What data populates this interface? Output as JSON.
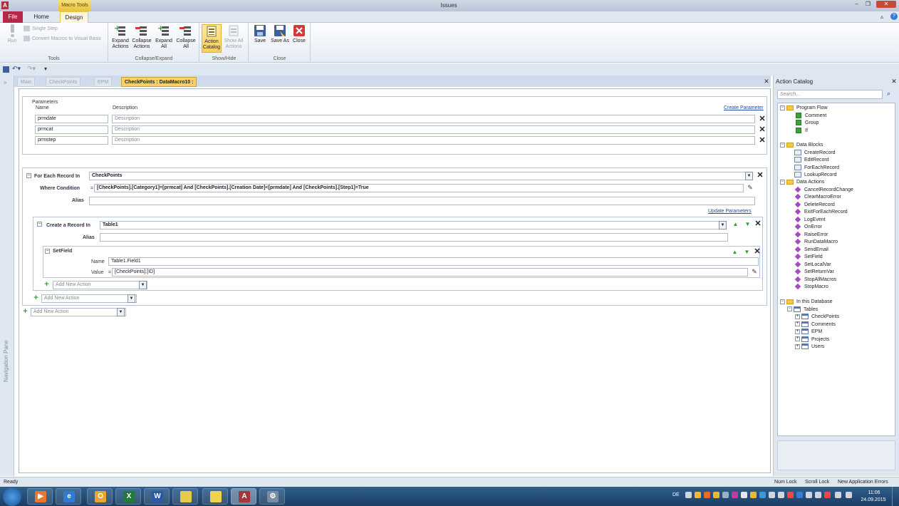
{
  "window": {
    "title": "Issues",
    "contextual_tab": "Macro Tools",
    "app_letter": "A"
  },
  "ribbon": {
    "tabs": [
      "File",
      "Home",
      "Design"
    ],
    "tools": {
      "run": "Run",
      "single_step": "Single Step",
      "convert": "Convert Macros to Visual Basic",
      "label": "Tools"
    },
    "collapse_expand": {
      "expand_actions": "Expand Actions",
      "collapse_actions": "Collapse Actions",
      "expand_all": "Expand All",
      "collapse_all": "Collapse All",
      "label": "Collapse/Expand"
    },
    "show_hide": {
      "action_catalog": "Action Catalog",
      "show_all_actions": "Show All Actions",
      "label": "Show/Hide"
    },
    "close_group": {
      "save": "Save",
      "save_as": "Save As",
      "close": "Close",
      "label": "Close"
    }
  },
  "doc_tabs": [
    "Main",
    "CheckPoints",
    "EPM",
    "CheckPoints : DataMacro10 :"
  ],
  "nav_pane": {
    "label": "Navigation Pane"
  },
  "parameters": {
    "title": "Parameters",
    "col_name": "Name",
    "col_desc": "Description",
    "create_link": "Create Parameter",
    "rows": [
      {
        "name": "prmdate",
        "desc_placeholder": "Description"
      },
      {
        "name": "prmcat",
        "desc_placeholder": "Description"
      },
      {
        "name": "prmstep",
        "desc_placeholder": "Description"
      }
    ]
  },
  "foreach": {
    "label": "For Each Record In",
    "value": "CheckPoints",
    "where_label": "Where Condition",
    "where_eq": "=",
    "where_value": "[CheckPoints].[Category1]=[prmcat] And [CheckPoints].[Creation Date]<[prmdate] And [CheckPoints].[Step1]=True",
    "alias_label": "Alias",
    "update_link": "Update Parameters"
  },
  "create_record": {
    "label": "Create a Record In",
    "value": "Table1",
    "alias_label": "Alias"
  },
  "setfield": {
    "label": "SetField",
    "name_label": "Name",
    "name_value": "Table1.Field1",
    "value_label": "Value",
    "value_eq": "=",
    "value_value": "[CheckPoints].[ID]"
  },
  "add_new_action": "Add New Action",
  "catalog": {
    "title": "Action Catalog",
    "search_placeholder": "Search...",
    "program_flow": {
      "label": "Program Flow",
      "items": [
        "Comment",
        "Group",
        "If"
      ]
    },
    "data_blocks": {
      "label": "Data Blocks",
      "items": [
        "CreateRecord",
        "EditRecord",
        "ForEachRecord",
        "LookupRecord"
      ]
    },
    "data_actions": {
      "label": "Data Actions",
      "items": [
        "CancelRecordChange",
        "ClearMacroError",
        "DeleteRecord",
        "ExitForEachRecord",
        "LogEvent",
        "OnError",
        "RaiseError",
        "RunDataMacro",
        "SendEmail",
        "SetField",
        "SetLocalVar",
        "SetReturnVar",
        "StopAllMacros",
        "StopMacro"
      ]
    },
    "in_db": {
      "label": "In this Database",
      "tables_label": "Tables",
      "tables": [
        "CheckPoints",
        "Comments",
        "EPM",
        "Projects",
        "Users"
      ]
    }
  },
  "status": {
    "left": "Ready",
    "num_lock": "Num Lock",
    "scroll_lock": "Scroll Lock",
    "new_errors": "New Application Errors"
  },
  "taskbar": {
    "lang": "DE",
    "time": "11:06",
    "date": "24.09.2015"
  }
}
